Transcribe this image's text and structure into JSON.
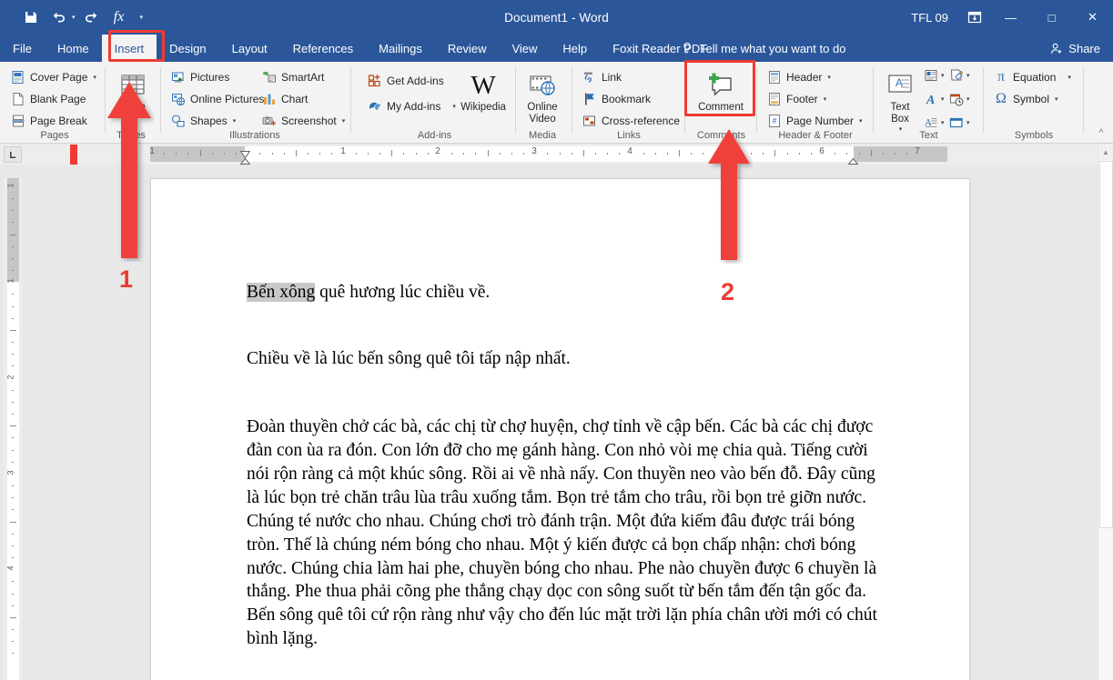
{
  "window": {
    "title": "Document1  -  Word",
    "user": "TFL 09",
    "minimize": "—",
    "maximize": "□",
    "close": "✕",
    "ribbon_display_options": "ribbon-display-options-icon",
    "accent": "#2b579a",
    "highlight_color": "#ef3b33"
  },
  "quick_access": [
    {
      "name": "save",
      "glyph": "save-icon"
    },
    {
      "name": "undo",
      "glyph": "undo-icon"
    },
    {
      "name": "redo",
      "glyph": "redo-icon"
    },
    {
      "name": "formula",
      "glyph": "fx-icon"
    },
    {
      "name": "customize",
      "glyph": "chevron-down-icon"
    }
  ],
  "tabs": [
    {
      "label": "File",
      "active": false
    },
    {
      "label": "Home",
      "active": false
    },
    {
      "label": "Insert",
      "active": true
    },
    {
      "label": "Design",
      "active": false
    },
    {
      "label": "Layout",
      "active": false
    },
    {
      "label": "References",
      "active": false
    },
    {
      "label": "Mailings",
      "active": false
    },
    {
      "label": "Review",
      "active": false
    },
    {
      "label": "View",
      "active": false
    },
    {
      "label": "Help",
      "active": false
    },
    {
      "label": "Foxit Reader PDF",
      "active": false
    }
  ],
  "tell_me": "Tell me what you want to do",
  "share": "Share",
  "ribbon": {
    "groups": [
      {
        "name": "pages",
        "label": "Pages",
        "items": [
          {
            "label": "Cover Page",
            "dropdown": true
          },
          {
            "label": "Blank Page",
            "dropdown": false
          },
          {
            "label": "Page Break",
            "dropdown": false
          }
        ]
      },
      {
        "name": "tables",
        "label": "Tables",
        "items": [
          {
            "label": "Table",
            "dropdown": true
          }
        ]
      },
      {
        "name": "illustrations",
        "label": "Illustrations",
        "items": [
          {
            "label": "Pictures",
            "dropdown": false
          },
          {
            "label": "Online Pictures",
            "dropdown": false
          },
          {
            "label": "Shapes",
            "dropdown": true
          },
          {
            "label": "SmartArt",
            "dropdown": false
          },
          {
            "label": "Chart",
            "dropdown": false
          },
          {
            "label": "Screenshot",
            "dropdown": true
          }
        ]
      },
      {
        "name": "add-ins",
        "label": "Add-ins",
        "items": [
          {
            "label": "Get Add-ins",
            "dropdown": false
          },
          {
            "label": "My Add-ins",
            "dropdown": true
          },
          {
            "label": "Wikipedia",
            "dropdown": false
          }
        ]
      },
      {
        "name": "media",
        "label": "Media",
        "items": [
          {
            "label": "Online Video",
            "dropdown": false
          }
        ]
      },
      {
        "name": "links",
        "label": "Links",
        "items": [
          {
            "label": "Link",
            "dropdown": false
          },
          {
            "label": "Bookmark",
            "dropdown": false
          },
          {
            "label": "Cross-reference",
            "dropdown": false
          }
        ]
      },
      {
        "name": "comments",
        "label": "Comments",
        "items": [
          {
            "label": "Comment",
            "dropdown": false
          }
        ]
      },
      {
        "name": "header-footer",
        "label": "Header & Footer",
        "items": [
          {
            "label": "Header",
            "dropdown": true
          },
          {
            "label": "Footer",
            "dropdown": true
          },
          {
            "label": "Page Number",
            "dropdown": true
          }
        ]
      },
      {
        "name": "text",
        "label": "Text",
        "items": [
          {
            "label": "Text Box",
            "dropdown": true
          }
        ]
      },
      {
        "name": "symbols",
        "label": "Symbols",
        "items": [
          {
            "label": "Equation",
            "dropdown": true
          },
          {
            "label": "Symbol",
            "dropdown": true
          }
        ]
      }
    ],
    "collapse": "collapse-ribbon-icon"
  },
  "ruler": {
    "horizontal_numbers": [
      "1",
      "1",
      "2",
      "3",
      "4",
      "5",
      "6",
      "7"
    ],
    "vertical_numbers": [
      "1",
      "1",
      "2",
      "3",
      "4"
    ]
  },
  "document": {
    "paragraph1_selected": "Bến xông",
    "paragraph1_rest": " quê hương lúc chiều về.",
    "paragraph2": "Chiều về là lúc bến sông quê tôi tấp nập nhất.",
    "paragraph3": "Đoàn thuyền chở các bà, các chị từ chợ huyện, chợ tỉnh về cập bến. Các bà các chị được đàn con ùa ra đón. Con lớn đỡ cho mẹ gánh hàng. Con nhỏ vòi mẹ chia quà. Tiếng cười nói rộn ràng cả một khúc sông. Rồi ai về nhà nấy. Con thuyền neo vào bến đỗ. Đây cũng là lúc bọn trẻ chăn trâu lùa trâu xuống tắm. Bọn trẻ tắm cho trâu, rồi bọn trẻ giỡn nước. Chúng té nước cho nhau. Chúng chơi trò đánh trận. Một đứa kiếm đâu được trái bóng tròn. Thế là chúng ném bóng cho nhau. Một ý kiến được cả bọn chấp nhận: chơi bóng nước. Chúng chia làm hai phe, chuyền bóng cho nhau. Phe nào chuyền được 6 chuyền là thắng. Phe thua phải cõng phe thắng chạy dọc con sông suốt từ bến tắm đến tận gốc đa. Bến sông quê tôi cứ rộn ràng như vậy cho đến lúc mặt trời lặn phía chân ười mới có chút bình lặng."
  },
  "annotations": [
    {
      "number": "1",
      "points_to": "Table button",
      "color": "#ee3b33"
    },
    {
      "number": "2",
      "points_to": "Comment button",
      "color": "#ee3b33"
    }
  ]
}
